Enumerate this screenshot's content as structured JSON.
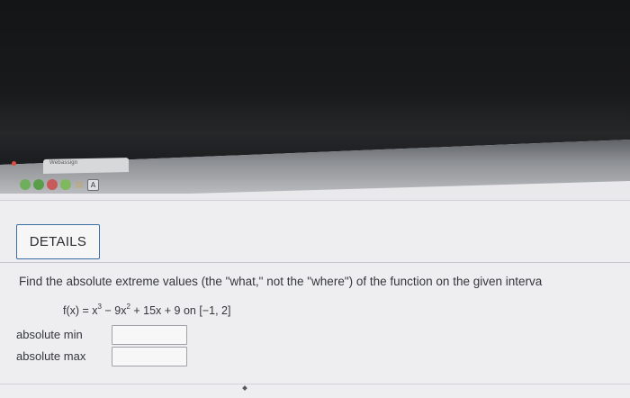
{
  "browser": {
    "tab_title": "Webassign",
    "toolbar_icons": [
      "green-circle-icon",
      "green-circle-icon",
      "red-circle-icon",
      "green-leaf-icon",
      "person-icon"
    ],
    "toolbar_letter": "A"
  },
  "assignment": {
    "details_label": "DETAILS",
    "question": "Find the absolute extreme values (the \"what,\" not the \"where\") of the function on the given interva",
    "formula": {
      "lhs": "f(x) = x",
      "p1": "3",
      "mid": " − 9x",
      "p2": "2",
      "rhs": " + 15x + 9 on [−1, 2]"
    },
    "fields": [
      {
        "label": "absolute min",
        "value": ""
      },
      {
        "label": "absolute max",
        "value": ""
      }
    ]
  },
  "colors": {
    "details_border": "#3a6ea5",
    "recording_dot": "#e04a3a"
  }
}
